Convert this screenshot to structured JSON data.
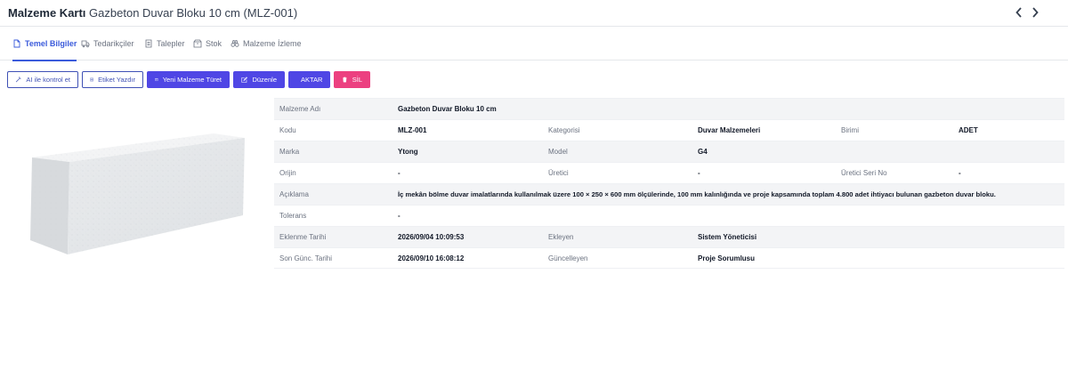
{
  "header": {
    "title_bold": "Malzeme Kartı",
    "title_rest": "Gazbeton Duvar Bloku 10 cm (MLZ-001)",
    "prev_icon": "chevron-left-icon",
    "next_icon": "chevron-right-icon"
  },
  "tabs": [
    {
      "label": "Temel Bilgiler",
      "icon": "document-icon",
      "active": true
    },
    {
      "label": "Tedarikçiler",
      "icon": "truck-icon",
      "active": false
    },
    {
      "label": "Talepler",
      "icon": "list-icon",
      "active": false
    },
    {
      "label": "Stok",
      "icon": "box-icon",
      "active": false
    },
    {
      "label": "Malzeme İzleme",
      "icon": "binoculars-icon",
      "active": false
    }
  ],
  "toolbar": {
    "ai_check": "AI ile kontrol et",
    "print_label": "Etiket Yazdır",
    "derive": "Yeni Malzeme Türet",
    "edit": "Düzenle",
    "transfer": "AKTAR",
    "delete": "SİL"
  },
  "colors": {
    "accent": "#3b5bdb",
    "primary_button": "#4f46e5",
    "danger_button": "#ec4080"
  },
  "details": {
    "name_label": "Malzeme Adı",
    "name_value": "Gazbeton Duvar Bloku 10 cm",
    "code_label": "Kodu",
    "code_value": "MLZ-001",
    "category_label": "Kategorisi",
    "category_value": "Duvar Malzemeleri",
    "unit_label": "Birimi",
    "unit_value": "ADET",
    "brand_label": "Marka",
    "brand_value": "Ytong",
    "model_label": "Model",
    "model_value": "G4",
    "origin_label": "Orijin",
    "origin_value": "-",
    "producer_label": "Üretici",
    "producer_value": "-",
    "serial_label": "Üretici Seri No",
    "serial_value": "-",
    "desc_label": "Açıklama",
    "desc_value": "İç mekân bölme duvar imalatlarında kullanılmak üzere 100 × 250 × 600 mm ölçülerinde, 100 mm kalınlığında ve proje kapsamında toplam 4.800 adet ihtiyacı bulunan gazbeton duvar bloku.",
    "tolerance_label": "Tolerans",
    "tolerance_value": "-",
    "added_date_label": "Eklenme Tarihi",
    "added_date_value": "2026/09/04 10:09:53",
    "added_by_label": "Ekleyen",
    "added_by_value": "Sistem Yöneticisi",
    "updated_date_label": "Son Günc. Tarihi",
    "updated_date_value": "2026/09/10 16:08:12",
    "updated_by_label": "Güncelleyen",
    "updated_by_value": "Proje Sorumlusu"
  }
}
